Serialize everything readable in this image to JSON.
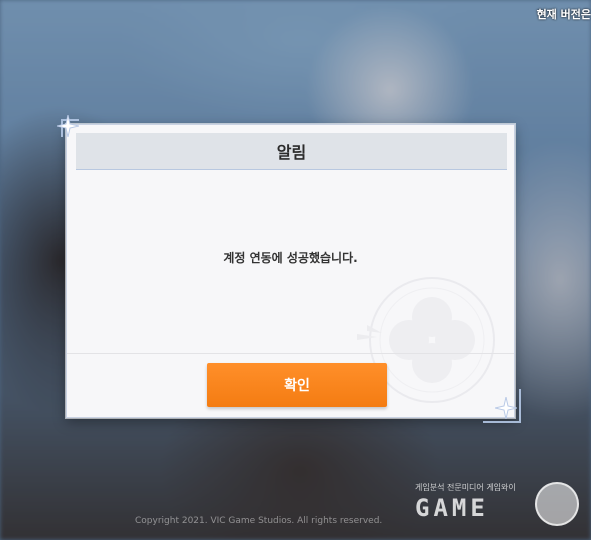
{
  "background": {
    "version_text": "현재 버전은",
    "copyright": "Copyright 2021. VIC Game Studios. All rights reserved."
  },
  "watermark": {
    "subtitle": "게임분석 전문미디어 게임와이",
    "logo": "GAME"
  },
  "dialog": {
    "title": "알림",
    "message": "계정 연동에 성공했습니다.",
    "confirm_label": "확인"
  },
  "colors": {
    "accent": "#f47c12",
    "header_bg": "#dfe3e8",
    "dialog_bg": "#f7f7f9"
  }
}
